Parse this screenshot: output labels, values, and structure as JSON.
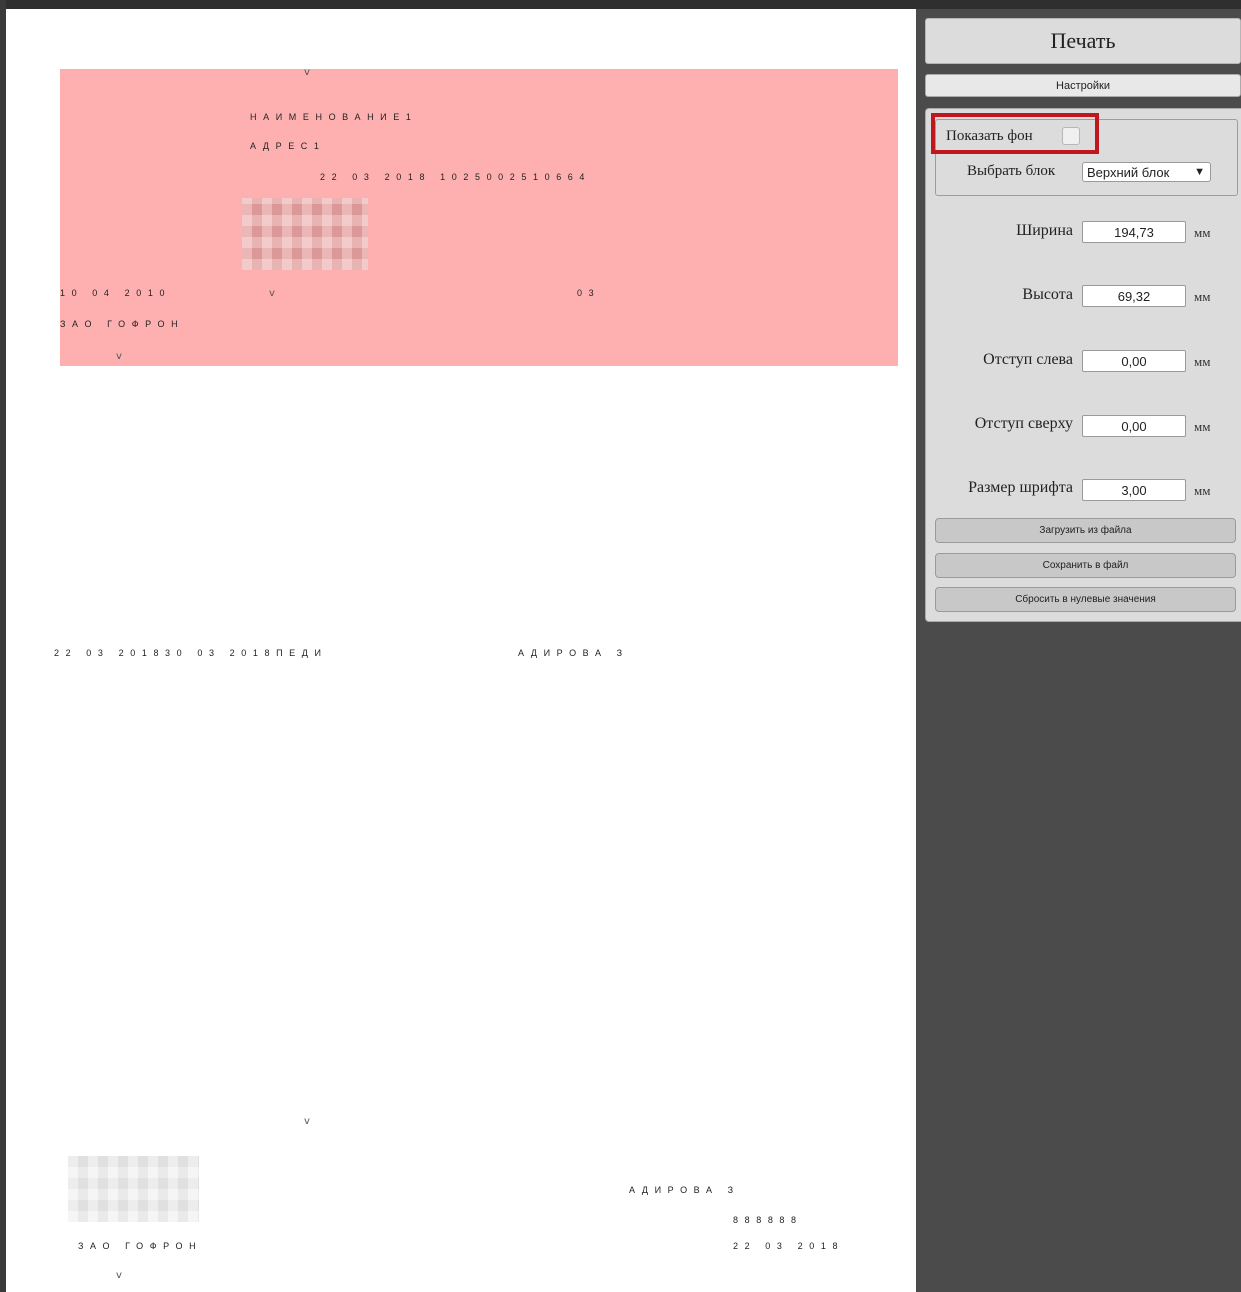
{
  "preview": {
    "top_block": {
      "mark_top": "v",
      "line_name": "НАИМЕНОВАНИЕ1",
      "line_address": "АДРЕС1",
      "line_date_code": "22 03 2018 1025002510664",
      "line_date2": "10 04 2010",
      "mark_mid": "v",
      "line_code": "03",
      "line_company": "ЗАО ГОФРОН",
      "mark_bottom": "v"
    },
    "middle_line": {
      "part1": "22 03 201830 03 2018ПЕДИ",
      "part2": "АДИРОВА З"
    },
    "bottom_block": {
      "mark_top": "v",
      "signer": "АДИРОВА З",
      "number": "888888",
      "company": "ЗАО ГОФРОН",
      "date": "22 03 2018",
      "mark_bottom": "v"
    }
  },
  "panel": {
    "print_label": "Печать",
    "settings_label": "Настройки",
    "show_background_label": "Показать фон",
    "show_background_checked": false,
    "select_block_label": "Выбрать блок",
    "select_block_value": "Верхний блок",
    "unit": "мм",
    "fields": {
      "width": {
        "label": "Ширина",
        "value": "194,73"
      },
      "height": {
        "label": "Высота",
        "value": "69,32"
      },
      "left": {
        "label": "Отступ слева",
        "value": "0,00"
      },
      "top": {
        "label": "Отступ сверху",
        "value": "0,00"
      },
      "font": {
        "label": "Размер шрифта",
        "value": "3,00"
      }
    },
    "load_label": "Загрузить из файла",
    "save_label": "Сохранить в файл",
    "reset_label": "Сбросить в нулевые значения"
  },
  "colors": {
    "top_block_background": "#feb0b0",
    "highlight_border": "#c1161c"
  }
}
